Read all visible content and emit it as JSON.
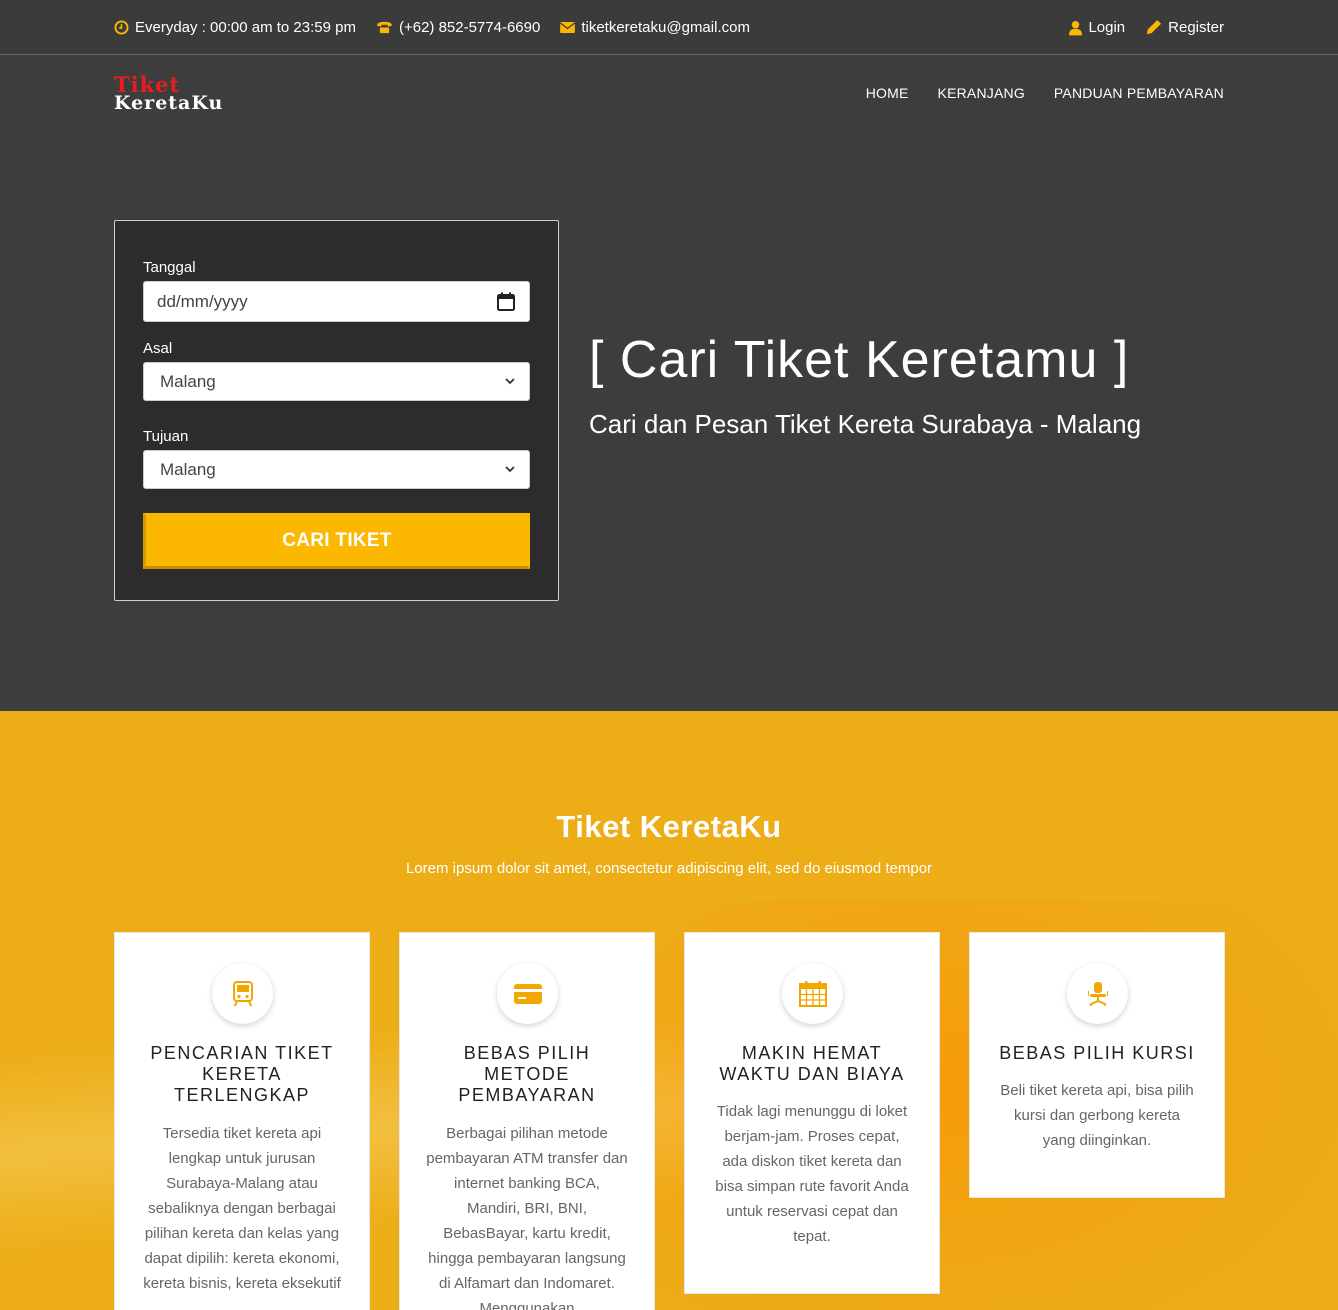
{
  "topbar": {
    "hours": "Everyday : 00:00 am to 23:59 pm",
    "phone": "(+62) 852-5774-6690",
    "email": "tiketkeretaku@gmail.com",
    "login": "Login",
    "register": "Register"
  },
  "logo": {
    "line1": "Tiket",
    "line2": "KeretaKu"
  },
  "nav": {
    "home": "HOME",
    "cart": "KERANJANG",
    "payment_guide": "PANDUAN PEMBAYARAN"
  },
  "search": {
    "date_label": "Tanggal",
    "date_placeholder": "dd/mm/yyyy",
    "origin_label": "Asal",
    "origin_value": "Malang",
    "dest_label": "Tujuan",
    "dest_value": "Malang",
    "submit": "CARI TIKET"
  },
  "hero": {
    "title": "[ Cari Tiket Keretamu ]",
    "subtitle": "Cari dan Pesan Tiket Kereta Surabaya - Malang"
  },
  "features": {
    "title": "Tiket KeretaKu",
    "subtitle": "Lorem ipsum dolor sit amet, consectetur adipiscing elit, sed do eiusmod tempor",
    "cards": [
      {
        "icon": "train-icon",
        "title": "PENCARIAN TIKET KERETA TERLENGKAP",
        "text": "Tersedia tiket kereta api lengkap untuk jurusan Surabaya-Malang atau sebaliknya dengan berbagai pilihan kereta dan kelas yang dapat dipilih: kereta ekonomi, kereta bisnis, kereta eksekutif"
      },
      {
        "icon": "credit-card-icon",
        "title": "BEBAS PILIH METODE PEMBAYARAN",
        "text": "Berbagai pilihan metode pembayaran ATM transfer dan internet banking BCA, Mandiri, BRI, BNI, BebasBayar, kartu kredit, hingga pembayaran langsung di Alfamart dan Indomaret. Menggunakan"
      },
      {
        "icon": "calendar-icon",
        "title": "MAKIN HEMAT WAKTU DAN BIAYA",
        "text": "Tidak lagi menunggu di loket berjam-jam. Proses cepat, ada diskon tiket kereta dan bisa simpan rute favorit Anda untuk reservasi cepat dan tepat."
      },
      {
        "icon": "seat-icon",
        "title": "BEBAS PILIH KURSI",
        "text": "Beli tiket kereta api, bisa pilih kursi dan gerbong kereta yang diinginkan."
      }
    ]
  },
  "colors": {
    "accent": "#fcb800",
    "dark_bg": "#3d3d3e",
    "section_yellow": "#ecad17"
  }
}
